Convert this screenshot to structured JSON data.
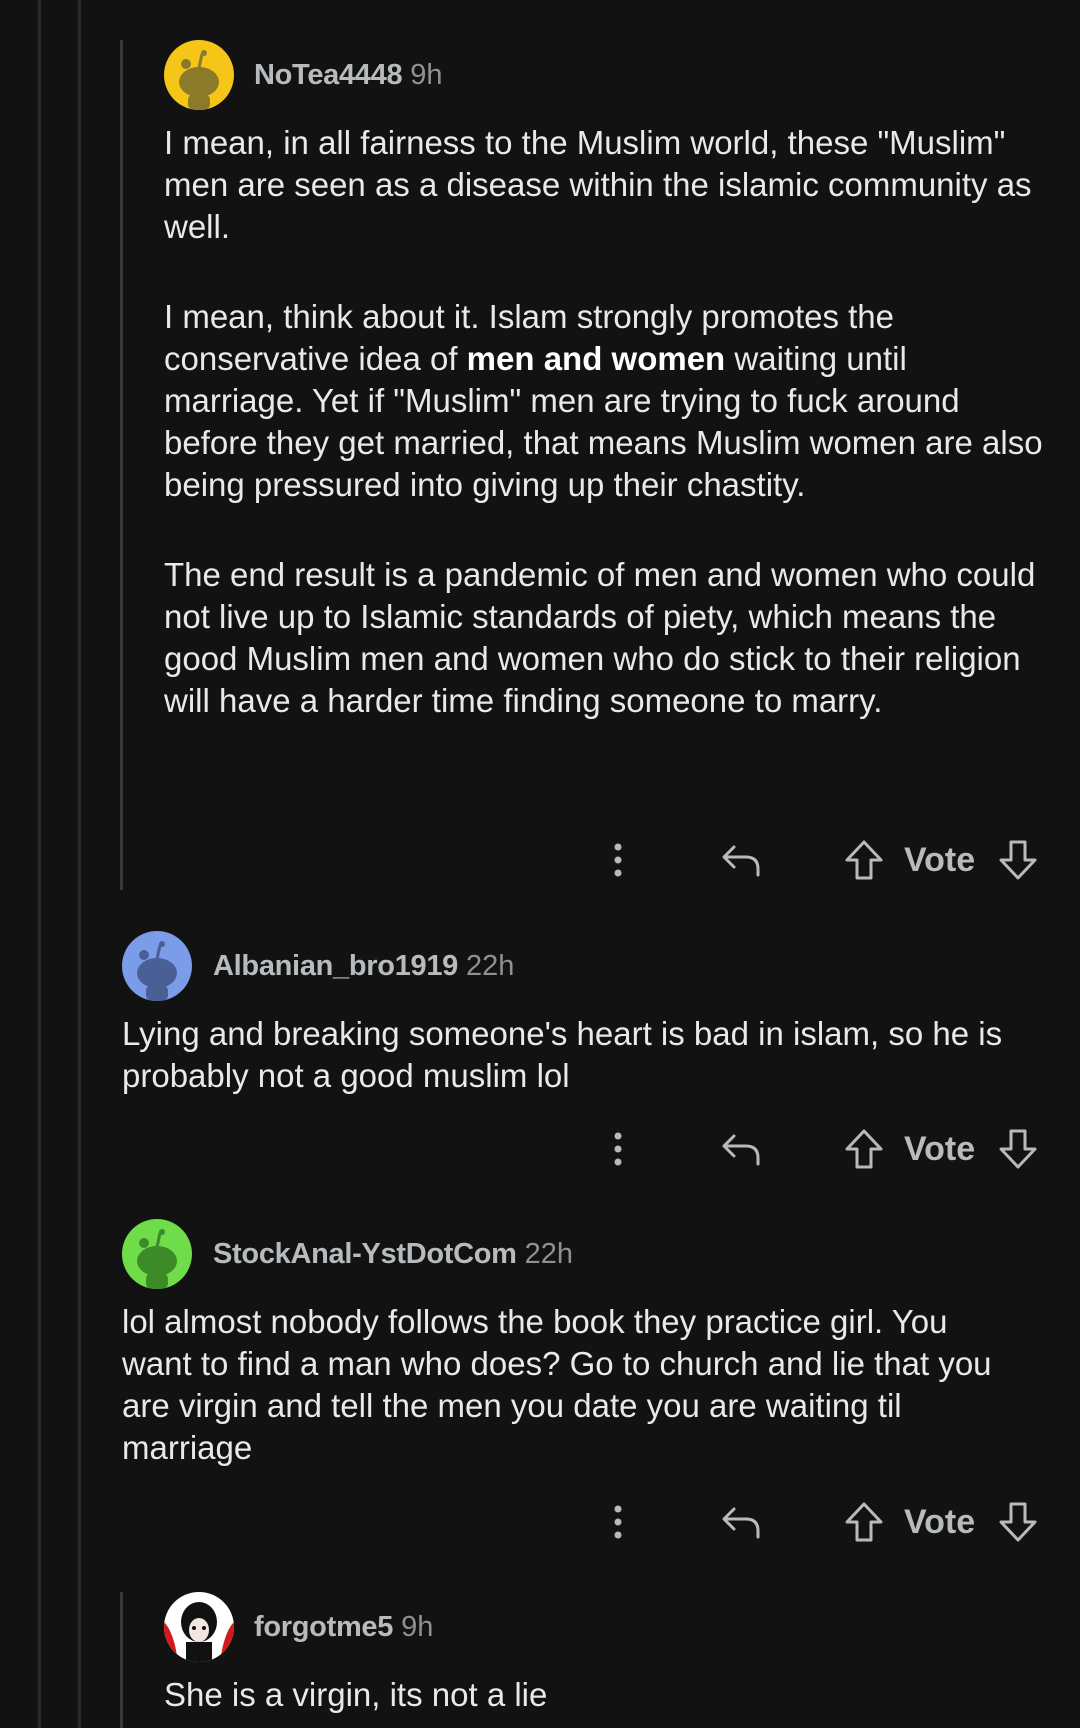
{
  "comments": [
    {
      "username": "NoTea4448",
      "age": "9h",
      "avatar_color": "#f5c518",
      "paragraphs": [
        {
          "text": "I mean, in all fairness to the Muslim world, these \"Muslim\" men are seen as a disease within the islamic community as well."
        },
        {
          "before": "I mean, think about it. Islam strongly promotes the conservative idea of ",
          "bold": "men and women",
          "after": " waiting until marriage. Yet if \"Muslim\" men are trying to fuck around before they get married, that means Muslim women are also being pressured into giving up their chastity."
        },
        {
          "text": "The end result is a pandemic of men and women who could not live up to Islamic standards of piety, which means the good Muslim men and women who do stick to their religion will have a harder time finding someone to marry."
        }
      ],
      "vote_label": "Vote"
    },
    {
      "username": "Albanian_bro1919",
      "age": "22h",
      "avatar_color": "#7b9ce8",
      "paragraphs": [
        {
          "text": "Lying and breaking someone's heart is bad in islam, so he is probably not a good muslim lol"
        }
      ],
      "vote_label": "Vote"
    },
    {
      "username": "StockAnal-YstDotCom",
      "age": "22h",
      "avatar_color": "#6fdc4a",
      "paragraphs": [
        {
          "text": "lol almost nobody follows the book they practice girl. You want to find a man who does?  Go to church and lie that you are virgin and tell the men you date you are waiting til marriage"
        }
      ],
      "vote_label": "Vote"
    },
    {
      "username": "forgotme5",
      "age": "9h",
      "avatar_color": "#d11a1a",
      "paragraphs": [
        {
          "text": "She is a virgin, its not a lie"
        }
      ]
    }
  ],
  "icons": {
    "more": "more-options-icon",
    "reply": "reply-icon",
    "upvote": "upvote-icon",
    "downvote": "downvote-icon"
  },
  "colors": {
    "background": "#121212",
    "text": "#e8e9ea",
    "muted": "#8e9193",
    "thread_line": "#2a2a2a"
  }
}
